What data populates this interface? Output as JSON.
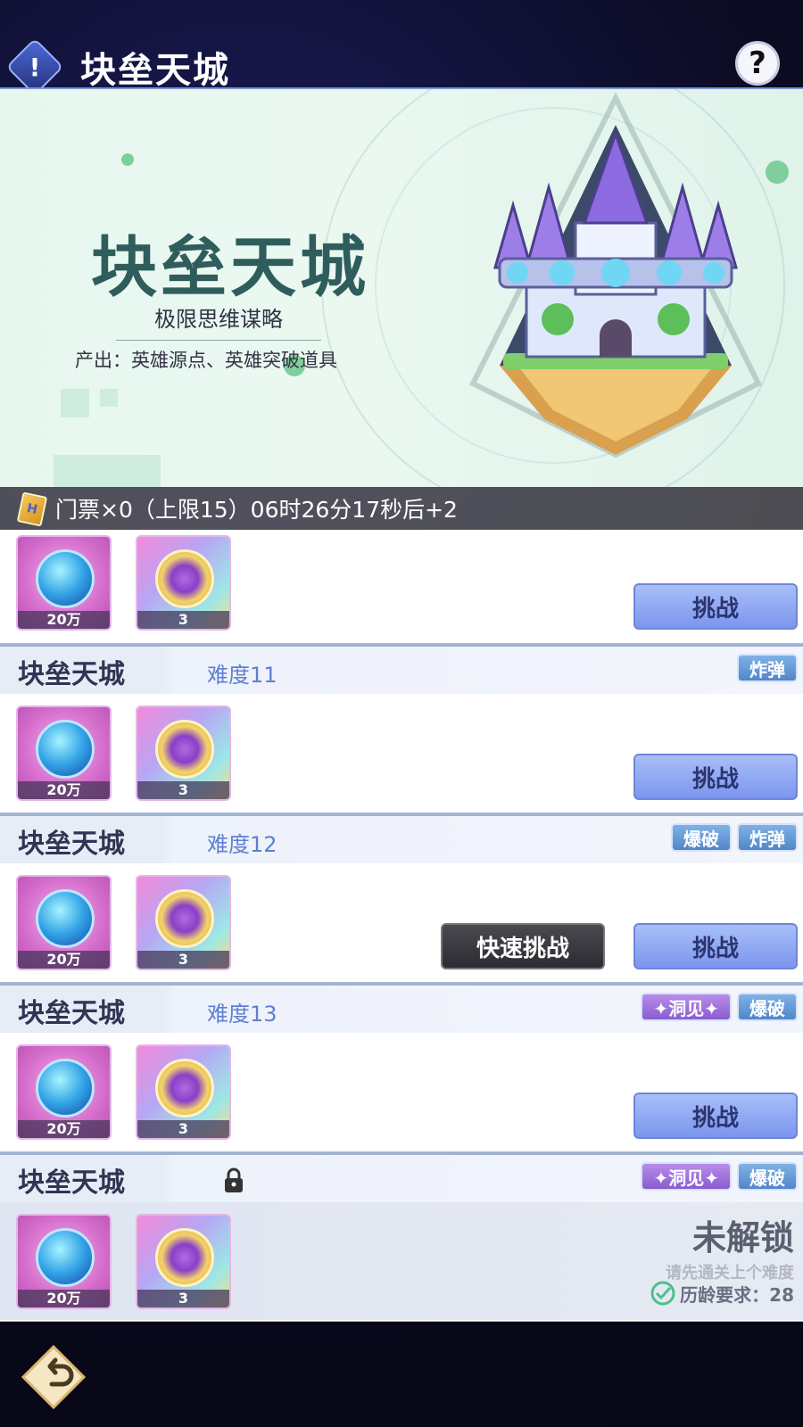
{
  "header": {
    "title": "块垒天城",
    "info_icon": "!",
    "help_icon": "?"
  },
  "banner": {
    "title": "块垒天城",
    "subtitle": "极限思维谋略",
    "output": "产出：英雄源点、英雄突破道具"
  },
  "ticket": {
    "icon_text": "H",
    "text": "门票×0（上限15）06时26分17秒后+2"
  },
  "rewards": {
    "item1_count": "20万",
    "item2_count": "3"
  },
  "stages": [
    {
      "name": "",
      "difficulty": "",
      "tags": [],
      "challenge_label": "挑战"
    },
    {
      "name": "块垒天城",
      "difficulty": "难度11",
      "tags": [
        "炸弹"
      ],
      "challenge_label": "挑战"
    },
    {
      "name": "块垒天城",
      "difficulty": "难度12",
      "tags": [
        "爆破",
        "炸弹"
      ],
      "quick_label": "快速挑战",
      "challenge_label": "挑战"
    },
    {
      "name": "块垒天城",
      "difficulty": "难度13",
      "tags": [
        "✦洞见✦",
        "爆破"
      ],
      "challenge_label": "挑战"
    },
    {
      "name": "块垒天城",
      "tags": [
        "✦洞见✦",
        "爆破"
      ],
      "locked_title": "未解锁",
      "locked_hint": "请先通关上个难度",
      "locked_req": "历龄要求：28"
    }
  ],
  "colors": {
    "accent": "#7c96ee",
    "tag_blue": "#5286c9",
    "tag_purple": "#8a5cd0"
  }
}
